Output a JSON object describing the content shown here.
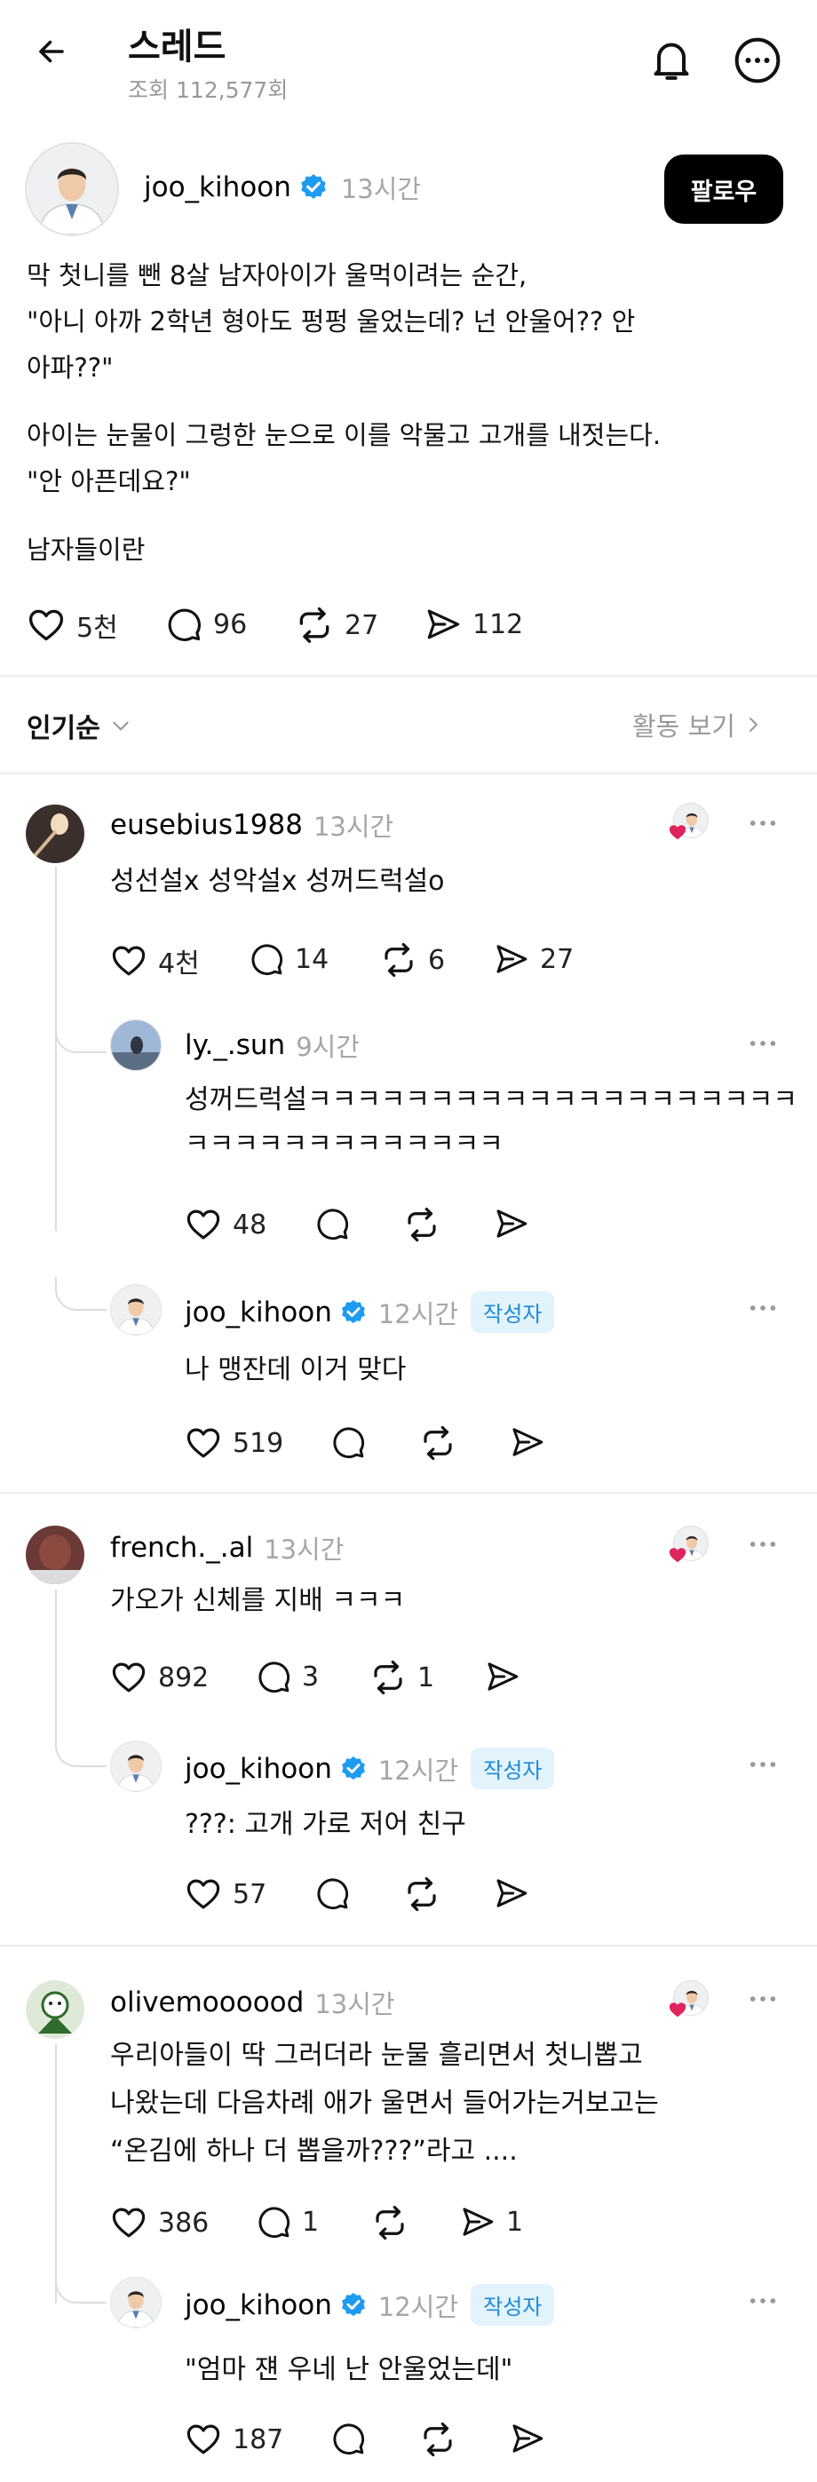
{
  "header": {
    "title": "스레드",
    "views": "조회 112,577회"
  },
  "post": {
    "username": "joo_kihoon",
    "time": "13시간",
    "follow_label": "팔로우",
    "lines": [
      "막 첫니를 뺀 8살 남자아이가 울먹이려는 순간,",
      "\"아니 아까 2학년 형아도 펑펑 울었는데? 넌 안울어?? 안",
      "아파??\"",
      "아이는 눈물이 그렁한 눈으로 이를 악물고 고개를 내젓는다.",
      "\"안 아픈데요?\"",
      "남자들이란"
    ],
    "likes": "5천",
    "comments": "96",
    "reposts": "27",
    "shares": "112"
  },
  "sort": {
    "label": "인기순",
    "activity": "활동 보기"
  },
  "author_badge": "작성자",
  "threads": [
    {
      "comment": {
        "username": "eusebius1988",
        "time": "13시간",
        "lines": [
          "성선설x 성악설x 성꺼드럭설o"
        ],
        "likes": "4천",
        "comments": "14",
        "reposts": "6",
        "shares": "27"
      },
      "replies": [
        {
          "username": "ly._.sun",
          "time": "9시간",
          "lines": [
            "성꺼드럭설ㅋㅋㅋㅋㅋㅋㅋㅋㅋㅋㅋㅋㅋㅋㅋㅋㅋㅋㅋㅋ",
            "ㅋㅋㅋㅋㅋㅋㅋㅋㅋㅋㅋㅋㅋ"
          ],
          "likes": "48"
        },
        {
          "username": "joo_kihoon",
          "time": "12시간",
          "lines": [
            "나 맹잔데 이거 맞다"
          ],
          "likes": "519"
        }
      ]
    },
    {
      "comment": {
        "username": "french._.al",
        "time": "13시간",
        "lines": [
          "가오가 신체를 지배 ㅋㅋㅋ"
        ],
        "likes": "892",
        "comments": "3",
        "reposts": "1",
        "shares": ""
      },
      "replies": [
        {
          "username": "joo_kihoon",
          "time": "12시간",
          "lines": [
            "???: 고개 가로 저어 친구"
          ],
          "likes": "57"
        }
      ]
    },
    {
      "comment": {
        "username": "olivemoooood",
        "time": "13시간",
        "lines": [
          "우리아들이 딱 그러더라 눈물 흘리면서 첫니뽑고",
          "나왔는데 다음차례 애가 울면서 들어가는거보고는",
          "“온김에 하나 더 뽑을까???”라고 ...."
        ],
        "likes": "386",
        "comments": "1",
        "reposts": "",
        "shares": "1"
      },
      "replies": [
        {
          "username": "joo_kihoon",
          "time": "12시간",
          "lines": [
            "\"엄마 쟨 우네 난 안울었는데\""
          ],
          "likes": "187"
        }
      ]
    }
  ],
  "colors": {
    "verified": "#1d9bf0",
    "liked_heart": "#e0245e",
    "badge_bg": "#e3f3fb",
    "badge_text": "#1b8ad8"
  }
}
